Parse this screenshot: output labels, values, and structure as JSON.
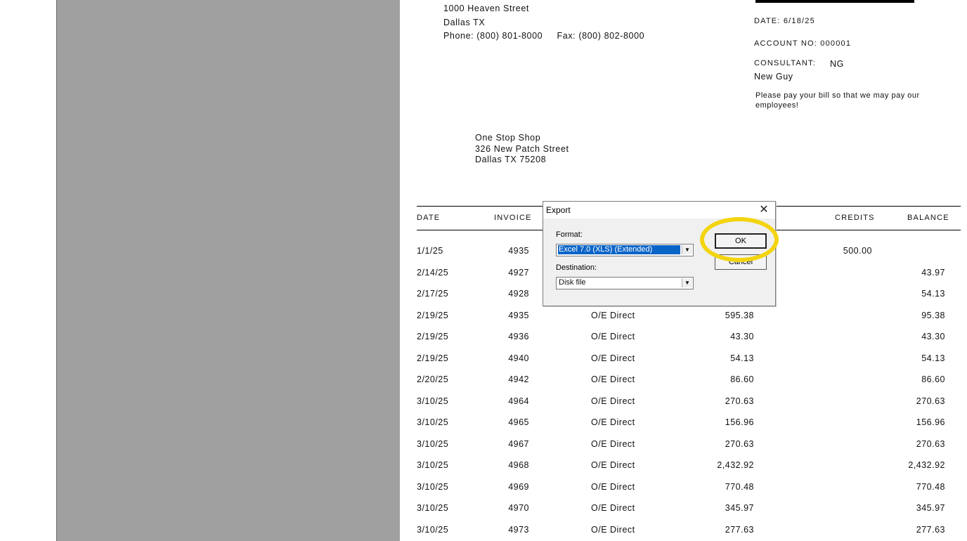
{
  "company": {
    "address_line": "1000 Heaven Street",
    "city_line": "Dallas  TX",
    "phone_fax_line": "Phone: (800) 801-8000     Fax: (800) 802-8000"
  },
  "statement": {
    "date": "DATE:  6/18/25",
    "account": "ACCOUNT NO:  000001",
    "consultant_label": "CONSULTANT:",
    "consultant_code": "NG",
    "consultant_name": "New Guy",
    "note": "Please pay your bill so that we may pay our employees!"
  },
  "customer": {
    "name": "One Stop Shop",
    "street": "326 New Patch Street",
    "city": "Dallas TX 75208"
  },
  "table": {
    "headers": {
      "date": "DATE",
      "invoice": "INVOICE",
      "credits": "CREDITS",
      "balance": "BALANCE"
    },
    "rows": [
      {
        "date": "1/1/25",
        "invoice": "4935",
        "desc": "",
        "amount": "",
        "credits": "500.00",
        "balance": ""
      },
      {
        "date": "2/14/25",
        "invoice": "4927",
        "desc": "",
        "amount": "",
        "credits": "",
        "balance": "43.97"
      },
      {
        "date": "2/17/25",
        "invoice": "4928",
        "desc": "",
        "amount": "",
        "credits": "",
        "balance": "54.13"
      },
      {
        "date": "2/19/25",
        "invoice": "4935",
        "desc": "O/E Direct",
        "amount": "595.38",
        "credits": "",
        "balance": "95.38"
      },
      {
        "date": "2/19/25",
        "invoice": "4936",
        "desc": "O/E Direct",
        "amount": "43.30",
        "credits": "",
        "balance": "43.30"
      },
      {
        "date": "2/19/25",
        "invoice": "4940",
        "desc": "O/E Direct",
        "amount": "54.13",
        "credits": "",
        "balance": "54.13"
      },
      {
        "date": "2/20/25",
        "invoice": "4942",
        "desc": "O/E Direct",
        "amount": "86.60",
        "credits": "",
        "balance": "86.60"
      },
      {
        "date": "3/10/25",
        "invoice": "4964",
        "desc": "O/E Direct",
        "amount": "270.63",
        "credits": "",
        "balance": "270.63"
      },
      {
        "date": "3/10/25",
        "invoice": "4965",
        "desc": "O/E Direct",
        "amount": "156.96",
        "credits": "",
        "balance": "156.96"
      },
      {
        "date": "3/10/25",
        "invoice": "4967",
        "desc": "O/E Direct",
        "amount": "270.63",
        "credits": "",
        "balance": "270.63"
      },
      {
        "date": "3/10/25",
        "invoice": "4968",
        "desc": "O/E Direct",
        "amount": "2,432.92",
        "credits": "",
        "balance": "2,432.92"
      },
      {
        "date": "3/10/25",
        "invoice": "4969",
        "desc": "O/E Direct",
        "amount": "770.48",
        "credits": "",
        "balance": "770.48"
      },
      {
        "date": "3/10/25",
        "invoice": "4970",
        "desc": "O/E Direct",
        "amount": "345.97",
        "credits": "",
        "balance": "345.97"
      },
      {
        "date": "3/10/25",
        "invoice": "4973",
        "desc": "O/E Direct",
        "amount": "277.63",
        "credits": "",
        "balance": "277.63"
      }
    ]
  },
  "dialog": {
    "title": "Export",
    "format_label": "Format:",
    "format_value": "Excel 7.0 (XLS) (Extended)",
    "destination_label": "Destination:",
    "destination_value": "Disk file",
    "ok_label": "OK",
    "cancel_label": "Cancel",
    "close_icon": "close-icon",
    "highlight_color": "#f3d40f",
    "selection_color": "#0a64c8"
  }
}
